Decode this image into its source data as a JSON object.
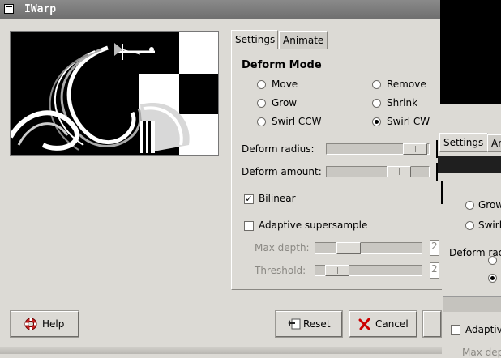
{
  "window": {
    "title": "IWarp"
  },
  "tabs": [
    {
      "label": "Settings",
      "active": true
    },
    {
      "label": "Animate",
      "active": false
    }
  ],
  "deform_mode": {
    "title": "Deform Mode",
    "options": [
      {
        "label": "Move",
        "selected": false
      },
      {
        "label": "Remove",
        "selected": false
      },
      {
        "label": "Grow",
        "selected": false
      },
      {
        "label": "Shrink",
        "selected": false
      },
      {
        "label": "Swirl CCW",
        "selected": false
      },
      {
        "label": "Swirl CW",
        "selected": true
      }
    ]
  },
  "sliders": {
    "deform_radius": {
      "label": "Deform radius:"
    },
    "deform_amount": {
      "label": "Deform amount:"
    }
  },
  "bilinear": {
    "label": "Bilinear",
    "checked": true
  },
  "adaptive": {
    "label": "Adaptive supersample",
    "checked": false
  },
  "max_depth": {
    "label": "Max depth:",
    "value": "2"
  },
  "threshold": {
    "label": "Threshold:",
    "value": "2"
  },
  "buttons": {
    "help": "Help",
    "reset": "Reset",
    "cancel": "Cancel"
  },
  "background_window": {
    "tab_settings": "Settings",
    "tab_animate": "An",
    "radio_grow": "Grow",
    "radio_swirl": "Swirl",
    "deform_radius": "Deform rad",
    "adaptive": "Adaptiv",
    "max_depth": "Max dep"
  },
  "colors": {
    "accent_selection": "#000000",
    "titlebar": "#7a7a7a"
  }
}
